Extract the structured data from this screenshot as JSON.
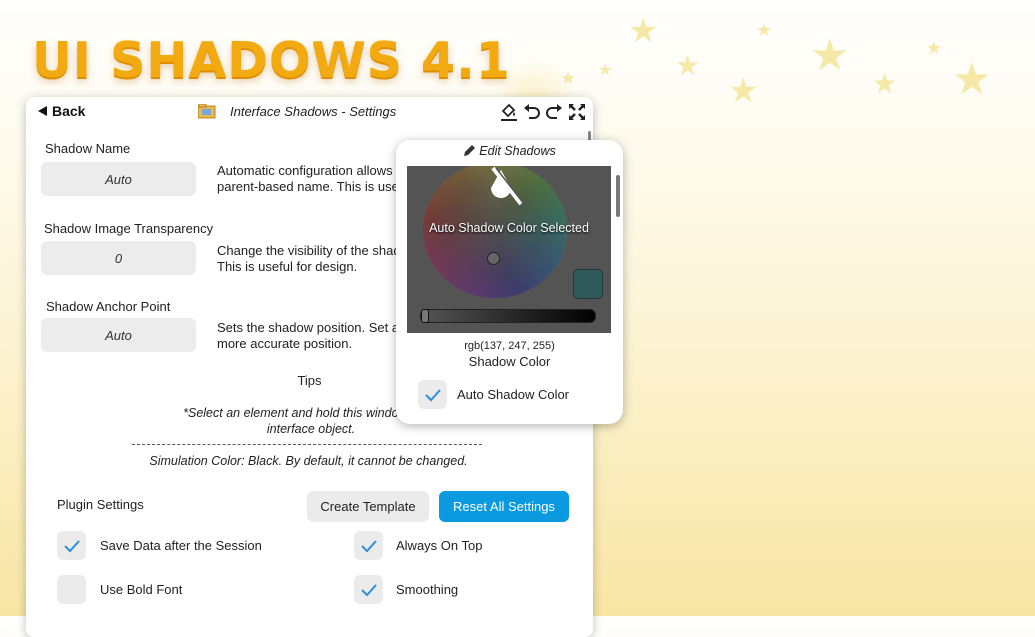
{
  "brand": {
    "title": "UI SHADOWS 4.1",
    "accent": "#f2aa10"
  },
  "window": {
    "back_label": "Back",
    "title": "Interface Shadows - Settings",
    "toolbar_icons": [
      "paint-bucket-icon",
      "undo-icon",
      "redo-icon",
      "expand-icon"
    ]
  },
  "settings": {
    "shadow_name": {
      "label": "Shadow Name",
      "value": "Auto",
      "desc_line1": "Automatic configuration allows",
      "desc_line2": "parent-based name. This is use"
    },
    "transparency": {
      "label": "Shadow Image Transparency",
      "value": "0",
      "desc_line1": "Change the visibility of the shad",
      "desc_line2": "This is useful for design."
    },
    "anchor": {
      "label": "Shadow Anchor Point",
      "value": "Auto",
      "desc_line1": "Sets the shadow position. Set a",
      "desc_line2": "more accurate position."
    }
  },
  "tips": {
    "heading": "Tips",
    "line1": "*Select an element and hold this window to ed",
    "line2": "interface object.",
    "simulation": "Simulation Color: Black. By default, it cannot be changed."
  },
  "plugin": {
    "label": "Plugin Settings",
    "create_template": "Create Template",
    "reset_all": "Reset All Settings",
    "reset_color": "#0b9ae0",
    "options": [
      {
        "label": "Save Data after the Session",
        "checked": true
      },
      {
        "label": "Always On Top",
        "checked": true
      },
      {
        "label": "Use Bold Font",
        "checked": false
      },
      {
        "label": "Smoothing",
        "checked": true
      }
    ]
  },
  "popup": {
    "title": "Edit Shadows",
    "auto_text": "Auto Shadow Color Selected",
    "rgb": "rgb(137, 247, 255)",
    "color_name": "Shadow Color",
    "auto_label": "Auto Shadow Color",
    "auto_checked": true
  }
}
